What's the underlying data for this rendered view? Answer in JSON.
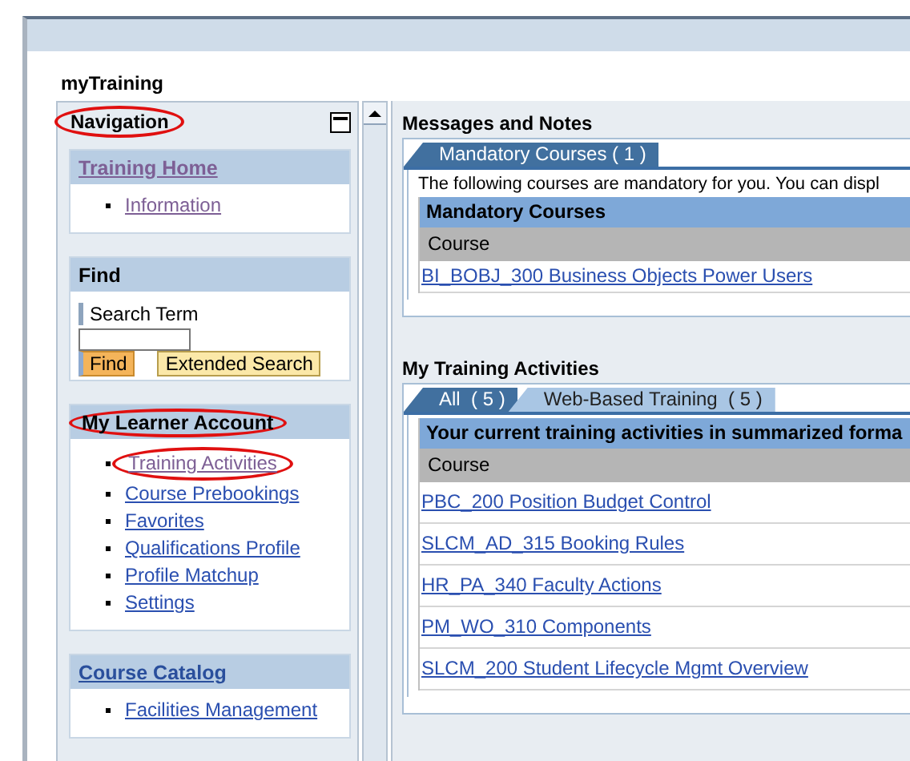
{
  "app": {
    "title": "myTraining"
  },
  "navigation": {
    "title": "Navigation",
    "circled": true,
    "trays": [
      {
        "kind": "links",
        "title": "Training Home",
        "title_link": true,
        "title_visited": true,
        "circled": false,
        "items": [
          {
            "label": "Information",
            "visited": true,
            "circled": false
          }
        ]
      },
      {
        "kind": "search",
        "title": "Find",
        "field_label": "Search Term",
        "buttons": [
          {
            "label": "Find",
            "kind": "primary"
          },
          {
            "label": "Extended Search",
            "kind": "secondary"
          }
        ]
      },
      {
        "kind": "links",
        "title": "My Learner Account",
        "title_link": false,
        "title_visited": false,
        "circled": true,
        "items": [
          {
            "label": "Training Activities",
            "visited": true,
            "circled": true
          },
          {
            "label": "Course Prebookings",
            "visited": false,
            "circled": false
          },
          {
            "label": "Favorites",
            "visited": false,
            "circled": false
          },
          {
            "label": "Qualifications Profile",
            "visited": false,
            "circled": false
          },
          {
            "label": "Profile Matchup",
            "visited": false,
            "circled": false
          },
          {
            "label": "Settings",
            "visited": false,
            "circled": false
          }
        ]
      },
      {
        "kind": "links",
        "title": "Course Catalog",
        "title_link": true,
        "title_visited": false,
        "circled": false,
        "items": [
          {
            "label": "Facilities Management",
            "visited": false,
            "circled": false
          }
        ]
      }
    ]
  },
  "sections": [
    {
      "title": "Messages and Notes",
      "tabs": [
        {
          "label": "Mandatory Courses ( 1 )",
          "selected": true
        }
      ],
      "intro": "The following courses are mandatory for you. You can displ",
      "table": {
        "title": "Mandatory Courses",
        "columns": [
          "Course"
        ],
        "rows": [
          "BI_BOBJ_300 Business Objects Power Users"
        ]
      }
    },
    {
      "title": "My Training Activities",
      "tabs": [
        {
          "label": "All  ( 5 )",
          "selected": true
        },
        {
          "label": "Web-Based Training  ( 5 )",
          "selected": false
        }
      ],
      "table": {
        "title": "Your current training activities in summarized forma",
        "columns": [
          "Course"
        ],
        "rows": [
          "PBC_200 Position Budget Control",
          "SLCM_AD_315 Booking Rules",
          "HR_PA_340 Faculty Actions",
          "PM_WO_310 Components",
          "SLCM_200 Student Lifecycle Mgmt Overview"
        ]
      }
    }
  ]
}
